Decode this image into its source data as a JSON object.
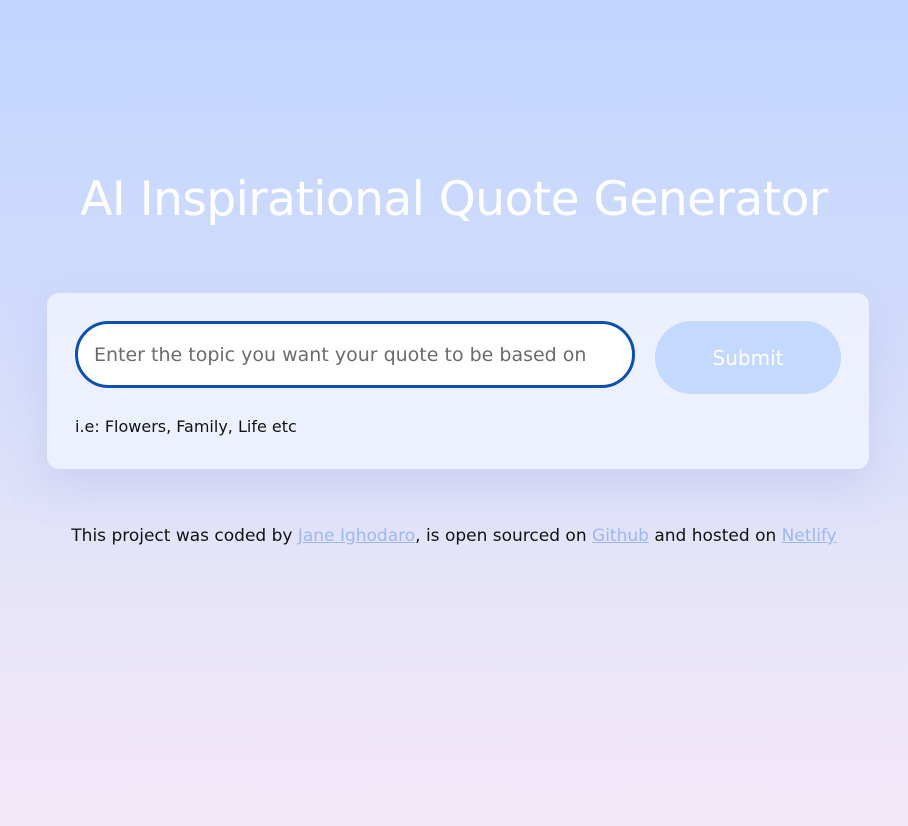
{
  "header": {
    "title": "AI Inspirational Quote Generator"
  },
  "form": {
    "placeholder": "Enter the topic you want your quote to be based on",
    "value": "",
    "submit_label": "Submit",
    "hint": "i.e: Flowers, Family, Life etc"
  },
  "footer": {
    "text_1": "This project was coded by ",
    "author_link": "Jane Ighodaro",
    "text_2": ", is open sourced on ",
    "github_link": "Github",
    "text_3": " and hosted on ",
    "netlify_link": "Netlify"
  },
  "colors": {
    "accent": "#0d4fb0",
    "button": "#c3d9ff",
    "link": "#9ab9f2"
  }
}
